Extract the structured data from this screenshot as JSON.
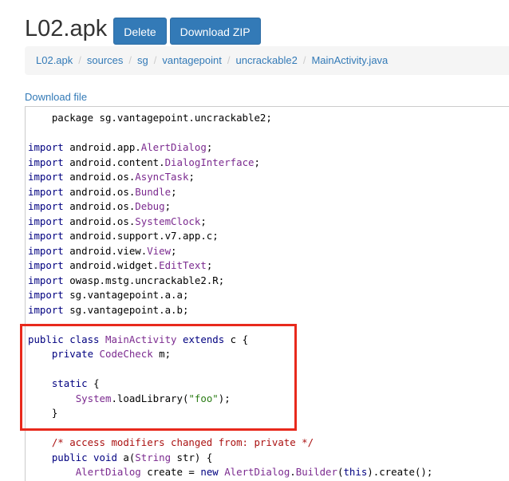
{
  "page": {
    "title": "L02.apk",
    "buttons": {
      "delete": "Delete",
      "download_zip": "Download ZIP"
    },
    "breadcrumb": [
      "L02.apk",
      "sources",
      "sg",
      "vantagepoint",
      "uncrackable2",
      "MainActivity.java"
    ],
    "breadcrumb_separator": "/",
    "download_link": "Download file"
  },
  "code_lines": [
    [
      {
        "t": "    package sg.vantagepoint.uncrackable2;",
        "c": ""
      }
    ],
    [],
    [
      {
        "t": "import",
        "c": "kw"
      },
      {
        "t": " android.app.",
        "c": ""
      },
      {
        "t": "AlertDialog",
        "c": "ty"
      },
      {
        "t": ";",
        "c": ""
      }
    ],
    [
      {
        "t": "import",
        "c": "kw"
      },
      {
        "t": " android.content.",
        "c": ""
      },
      {
        "t": "DialogInterface",
        "c": "ty"
      },
      {
        "t": ";",
        "c": ""
      }
    ],
    [
      {
        "t": "import",
        "c": "kw"
      },
      {
        "t": " android.os.",
        "c": ""
      },
      {
        "t": "AsyncTask",
        "c": "ty"
      },
      {
        "t": ";",
        "c": ""
      }
    ],
    [
      {
        "t": "import",
        "c": "kw"
      },
      {
        "t": " android.os.",
        "c": ""
      },
      {
        "t": "Bundle",
        "c": "ty"
      },
      {
        "t": ";",
        "c": ""
      }
    ],
    [
      {
        "t": "import",
        "c": "kw"
      },
      {
        "t": " android.os.",
        "c": ""
      },
      {
        "t": "Debug",
        "c": "ty"
      },
      {
        "t": ";",
        "c": ""
      }
    ],
    [
      {
        "t": "import",
        "c": "kw"
      },
      {
        "t": " android.os.",
        "c": ""
      },
      {
        "t": "SystemClock",
        "c": "ty"
      },
      {
        "t": ";",
        "c": ""
      }
    ],
    [
      {
        "t": "import",
        "c": "kw"
      },
      {
        "t": " android.support.v7.app.c;",
        "c": ""
      }
    ],
    [
      {
        "t": "import",
        "c": "kw"
      },
      {
        "t": " android.view.",
        "c": ""
      },
      {
        "t": "View",
        "c": "ty"
      },
      {
        "t": ";",
        "c": ""
      }
    ],
    [
      {
        "t": "import",
        "c": "kw"
      },
      {
        "t": " android.widget.",
        "c": ""
      },
      {
        "t": "EditText",
        "c": "ty"
      },
      {
        "t": ";",
        "c": ""
      }
    ],
    [
      {
        "t": "import",
        "c": "kw"
      },
      {
        "t": " owasp.mstg.uncrackable2.R;",
        "c": ""
      }
    ],
    [
      {
        "t": "import",
        "c": "kw"
      },
      {
        "t": " sg.vantagepoint.a.a;",
        "c": ""
      }
    ],
    [
      {
        "t": "import",
        "c": "kw"
      },
      {
        "t": " sg.vantagepoint.a.b;",
        "c": ""
      }
    ],
    [],
    [
      {
        "t": "public class",
        "c": "kw"
      },
      {
        "t": " ",
        "c": ""
      },
      {
        "t": "MainActivity",
        "c": "ty"
      },
      {
        "t": " ",
        "c": ""
      },
      {
        "t": "extends",
        "c": "kw"
      },
      {
        "t": " c {",
        "c": ""
      }
    ],
    [
      {
        "t": "    ",
        "c": ""
      },
      {
        "t": "private",
        "c": "kw"
      },
      {
        "t": " ",
        "c": ""
      },
      {
        "t": "CodeCheck",
        "c": "ty"
      },
      {
        "t": " m;",
        "c": ""
      }
    ],
    [],
    [
      {
        "t": "    ",
        "c": ""
      },
      {
        "t": "static",
        "c": "kw"
      },
      {
        "t": " {",
        "c": ""
      }
    ],
    [
      {
        "t": "        ",
        "c": ""
      },
      {
        "t": "System",
        "c": "ty"
      },
      {
        "t": ".loadLibrary(",
        "c": ""
      },
      {
        "t": "\"foo\"",
        "c": "str"
      },
      {
        "t": ");",
        "c": ""
      }
    ],
    [
      {
        "t": "    }",
        "c": ""
      }
    ],
    [],
    [
      {
        "t": "    ",
        "c": ""
      },
      {
        "t": "/* access modifiers changed from: private */",
        "c": "cm"
      }
    ],
    [
      {
        "t": "    ",
        "c": ""
      },
      {
        "t": "public void",
        "c": "kw"
      },
      {
        "t": " a(",
        "c": ""
      },
      {
        "t": "String",
        "c": "ty"
      },
      {
        "t": " str) {",
        "c": ""
      }
    ],
    [
      {
        "t": "        ",
        "c": ""
      },
      {
        "t": "AlertDialog",
        "c": "ty"
      },
      {
        "t": " create = ",
        "c": ""
      },
      {
        "t": "new",
        "c": "kw"
      },
      {
        "t": " ",
        "c": ""
      },
      {
        "t": "AlertDialog",
        "c": "ty"
      },
      {
        "t": ".",
        "c": ""
      },
      {
        "t": "Builder",
        "c": "ty"
      },
      {
        "t": "(",
        "c": ""
      },
      {
        "t": "this",
        "c": "kw"
      },
      {
        "t": ").create();",
        "c": ""
      }
    ]
  ],
  "colors": {
    "button_bg": "#337ab7",
    "link": "#337ab7",
    "keyword": "#000080",
    "type": "#7b2a8f",
    "string": "#2a7b14",
    "comment": "#aa1111",
    "highlight_box": "#e8291c"
  }
}
